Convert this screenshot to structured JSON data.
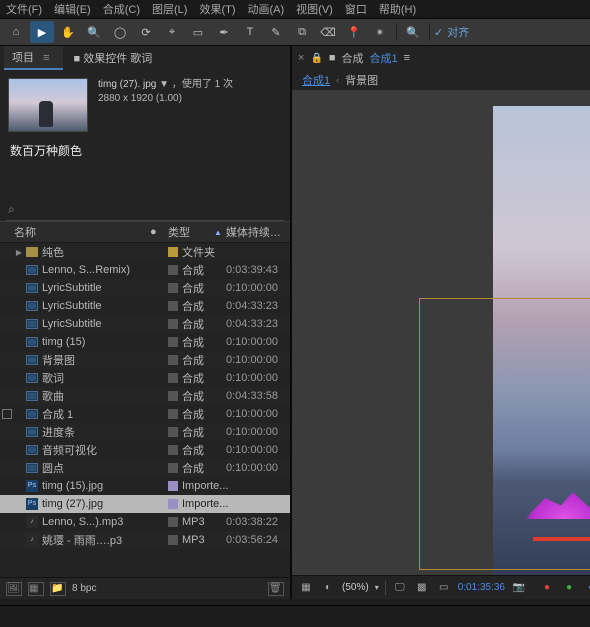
{
  "menu": {
    "items": [
      "文件(F)",
      "编辑(E)",
      "合成(C)",
      "图层(L)",
      "效果(T)",
      "动画(A)",
      "视图(V)",
      "窗口",
      "帮助(H)"
    ]
  },
  "toolbar": {
    "tools": [
      "home",
      "select",
      "hand",
      "zoom",
      "orbit",
      "rotate",
      "camera",
      "rect",
      "pen",
      "text",
      "brush",
      "stamp",
      "eraser",
      "puppet",
      "roto"
    ],
    "align_check": "✓",
    "align_label": "对齐"
  },
  "left": {
    "tabs": {
      "project": "项目",
      "menu_icon": "≡",
      "fx_tab_prefix": "■",
      "fx_tab": "效果控件 歌词"
    },
    "preview": {
      "title": "timg (27). jpg",
      "used_prefix": "▼ ，使用了 ",
      "used_count": "1",
      "used_suffix": " 次",
      "dims": "2880 x 1920 (1.00)"
    },
    "millions": "数百万种颜色",
    "search_placeholder": "",
    "columns": {
      "name": "名称",
      "tag": "●",
      "type": "类型",
      "duration": "媒体持续…"
    },
    "rows": [
      {
        "twist": "▶",
        "icon": "folder",
        "name": "纯色",
        "tag": "#b89a3c",
        "type": "文件夹",
        "dur": ""
      },
      {
        "twist": "",
        "icon": "comp",
        "name": "Lenno, S...Remix)",
        "tag": "#555",
        "type": "合成",
        "dur": "0:03:39:43"
      },
      {
        "twist": "",
        "icon": "comp",
        "name": "LyricSubtitle",
        "tag": "#555",
        "type": "合成",
        "dur": "0:10:00:00"
      },
      {
        "twist": "",
        "icon": "comp",
        "name": "LyricSubtitle",
        "tag": "#555",
        "type": "合成",
        "dur": "0:04:33:23"
      },
      {
        "twist": "",
        "icon": "comp",
        "name": "LyricSubtitle",
        "tag": "#555",
        "type": "合成",
        "dur": "0:04:33:23"
      },
      {
        "twist": "",
        "icon": "comp",
        "name": "timg (15)",
        "tag": "#555",
        "type": "合成",
        "dur": "0:10:00:00"
      },
      {
        "twist": "",
        "icon": "comp",
        "name": "背景图",
        "tag": "#555",
        "type": "合成",
        "dur": "0:10:00:00"
      },
      {
        "twist": "",
        "icon": "comp",
        "name": "歌词",
        "tag": "#555",
        "type": "合成",
        "dur": "0:10:00:00"
      },
      {
        "twist": "",
        "icon": "comp",
        "name": "歌曲",
        "tag": "#555",
        "type": "合成",
        "dur": "0:04:33:58"
      },
      {
        "twist": "",
        "icon": "comp",
        "name": "合成 1",
        "tag": "#555",
        "type": "合成",
        "dur": "0:10:00:00",
        "checkbox": true
      },
      {
        "twist": "",
        "icon": "comp",
        "name": "进度条",
        "tag": "#555",
        "type": "合成",
        "dur": "0:10:00:00"
      },
      {
        "twist": "",
        "icon": "comp",
        "name": "音频可视化",
        "tag": "#555",
        "type": "合成",
        "dur": "0:10:00:00"
      },
      {
        "twist": "",
        "icon": "comp",
        "name": "圆点",
        "tag": "#555",
        "type": "合成",
        "dur": "0:10:00:00"
      },
      {
        "twist": "",
        "icon": "psd",
        "name": "timg (15).jpg",
        "tag": "#9a8fc2",
        "type": "Importe...",
        "dur": ""
      },
      {
        "twist": "",
        "icon": "psd",
        "name": "timg (27).jpg",
        "tag": "#9a8fc2",
        "type": "Importe...",
        "dur": "",
        "selected": true
      },
      {
        "twist": "",
        "icon": "mp3",
        "name": "Lenno, S...).mp3",
        "tag": "#555",
        "type": "MP3",
        "dur": "0:03:38:22"
      },
      {
        "twist": "",
        "icon": "mp3",
        "name": "姚璎 - 雨雨….p3",
        "tag": "#555",
        "type": "MP3",
        "dur": "0:03:56:24"
      }
    ],
    "footer": {
      "bpc": "8 bpc"
    }
  },
  "right": {
    "tabs": {
      "close": "×",
      "lock": "🔒",
      "prefix": "■",
      "label": "合成",
      "active": "合成1",
      "menu": "≡"
    },
    "breadcrumb": {
      "a": "合成1",
      "b": "背景图"
    },
    "footer": {
      "zoom": "(50%)",
      "timecode": "0:01:35:36"
    }
  }
}
